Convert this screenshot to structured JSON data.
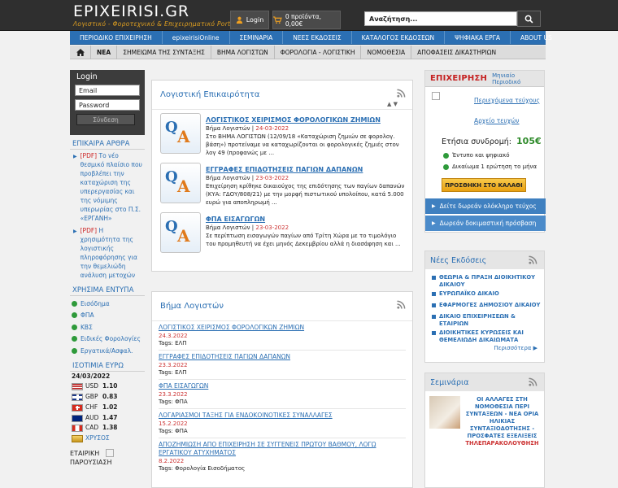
{
  "header": {
    "logo": "EPIXEIRISI.GR",
    "slogan": "Λογιστικό - Φοροτεχνικό & Επιχειρηματικό Portal",
    "login": "Login",
    "cart": "0 προϊόντα, 0,00€",
    "search_placeholder": "Αναζήτηση..."
  },
  "nav_main": [
    "ΠΕΡΙΟΔΙΚΟ ΕΠΙΧΕΙΡΗΣΗ",
    "epixeirisiOnline",
    "ΣΕΜΙΝΑΡΙΑ",
    "ΝΕΕΣ ΕΚΔΟΣΕΙΣ",
    "ΚΑΤΑΛΟΓΟΣ ΕΚΔΟΣΕΩΝ",
    "ΨΗΦΙΑΚΑ ΕΡΓΑ",
    "ABOUT US"
  ],
  "nav_sub": [
    "ΝΕΑ",
    "ΣΗΜΕΙΩΜΑ ΤΗΣ ΣΥΝΤΑΞΗΣ",
    "ΒΗΜΑ ΛΟΓΙΣΤΩΝ",
    "ΦΟΡΟΛΟΓΙΑ - ΛΟΓΙΣΤΙΚΗ",
    "ΝΟΜΟΘΕΣΙΑ",
    "ΑΠΟΦΑΣΕΙΣ ΔΙΚΑΣΤΗΡΙΩΝ"
  ],
  "login_box": {
    "title": "Login",
    "email": "Email",
    "password": "Password",
    "submit": "Σύνδεση"
  },
  "epikaira": {
    "title": "ΕΠΙΚΑΙΡΑ ΑΡΘΡΑ",
    "articles": [
      {
        "tag": "[PDF]",
        "text": "Το νέο θεσμικό πλαίσιο που προβλέπει την καταχώριση της υπερεργασίας και της νόμιμης υπερωρίας στο Π.Σ. «ΕΡΓΑΝΗ»"
      },
      {
        "tag": "[PDF]",
        "text": "Η χρησιμότητα της λογιστικής πληροφόρησης για την θεμελιώδη ανάλυση μετοχών"
      }
    ]
  },
  "forms": {
    "title": "ΧΡΗΣΙΜΑ ΕΝΤΥΠΑ",
    "items": [
      "Εισόδημα",
      "ΦΠΑ",
      "ΚΒΣ",
      "Ειδικές Φορολογίες",
      "Εργατικά/Ασφαλ."
    ]
  },
  "fx": {
    "title": "ΙΣΟΤΙΜΙΑ ΕΥΡΩ",
    "date": "24/03/2022",
    "rates": [
      {
        "cur": "USD",
        "val": "1.10",
        "flag": "#3c5aa6"
      },
      {
        "cur": "GBP",
        "val": "0.83",
        "flag": "#1f3a8a"
      },
      {
        "cur": "CHF",
        "val": "1.02",
        "flag": "#d52b1e"
      },
      {
        "cur": "AUD",
        "val": "1.47",
        "flag": "#00247d"
      },
      {
        "cur": "CAD",
        "val": "1.38",
        "flag": "#d52b1e"
      }
    ],
    "gold": "ΧΡΥΣΟΣ"
  },
  "presentation": {
    "text": "ΕΤΑΙΡΙΚΗ ΠΑΡΟΥΣΙΑΣΗ"
  },
  "news": {
    "title": "Λογιστική Επικαιρότητα",
    "sort": "▲ ▼",
    "items": [
      {
        "title": "ΛΟΓΙΣΤΙΚΟΣ ΧΕΙΡΙΣΜΟΣ ΦΟΡΟΛΟΓΙΚΩΝ ΖΗΜΙΩΝ",
        "section": "Βήμα Λογιστών",
        "date": "24-03-2022",
        "excerpt": "Στο ΒΗΜΑ ΛΟΓΙΣΤΩΝ (12/09/18 «Καταχώριση ζημιών σε φορολογ. βάση») προτείναμε να καταχωρίζονται οι φορολογικές ζημιές στον λογ 49 (προφανώς με ..."
      },
      {
        "title": "ΕΓΓΡΑΦΕΣ ΕΠΙΔΟΤΗΣΕΙΣ ΠΑΓΙΩΝ ΔΑΠΑΝΩΝ",
        "section": "Βήμα Λογιστών",
        "date": "23-03-2022",
        "excerpt": "Επιχείρηση κρίθηκε δικαιούχος της επιδότησης των παγίων δαπανών (ΚΥΑ: ΓΔΟΥ/808/21) με την μορφή πιστωτικού υπολοίπου, κατά 5.000 ευρώ για αποπληρωμή ..."
      },
      {
        "title": "ΦΠΑ ΕΙΣΑΓΩΓΩΝ",
        "section": "Βήμα Λογιστών",
        "date": "23-03-2022",
        "excerpt": "Σε περίπτωση εισαγωγών παγίων από Τρίτη Χώρα με το τιμολόγιο του προμηθευτή να έχει μηνός Δεκεμβρίου αλλά η διασάφηση και ..."
      }
    ]
  },
  "vima": {
    "title": "Βήμα Λογιστών",
    "items": [
      {
        "title": "ΛΟΓΙΣΤΙΚΟΣ ΧΕΙΡΙΣΜΟΣ ΦΟΡΟΛΟΓΙΚΩΝ ΖΗΜΙΩΝ",
        "date": "24.3.2022",
        "tag": "Tags: ΕΛΠ"
      },
      {
        "title": "ΕΓΓΡΑΦΕΣ ΕΠΙΔΟΤΗΣΕΙΣ ΠΑΓΙΩΝ ΔΑΠΑΝΩΝ",
        "date": "23.3.2022",
        "tag": "Tags: ΕΛΠ"
      },
      {
        "title": "ΦΠΑ ΕΙΣΑΓΩΓΩΝ",
        "date": "23.3.2022",
        "tag": "Tags: ΦΠΑ"
      },
      {
        "title": "ΛΟΓΑΡΙΑΣΜΟΙ ΤΑΞΗΣ ΓΙΑ ΕΝΔΟΚΟΙΝΟΤΙΚΕΣ ΣΥΝΑΛΛΑΓΕΣ",
        "date": "15.2.2022",
        "tag": "Tags: ΦΠΑ"
      },
      {
        "title": "ΑΠΟΖΗΜΙΩΣΗ ΑΠΟ ΕΠΙΧΕΙΡΗΣΗ ΣΕ ΣΥΓΓΕΝΕΙΣ ΠΡΩΤΟΥ ΒΑΘΜΟΥ, ΛΟΓΩ ΕΡΓΑΤΙΚΟΥ ΑΤΥΧΗΜΑΤΟΣ",
        "date": "8.2.2022",
        "tag": "Tags: Φορολογία Εισοδήματος"
      }
    ]
  },
  "magazine": {
    "brand": "ΕΠΙΧΕΙΡΗΣΗ",
    "subtitle": "Μηνιαίο Περιοδικό",
    "issues": "Περιεχόμενα τεύχους",
    "archive": "Αρχείο τευχών",
    "price_label": "Ετήσια συνδρομή:",
    "price": "105€",
    "feat1": "Έντυπο και ψηφιακό",
    "feat2": "Δικαίωμα 1 ερώτηση το μήνα",
    "cart": "ΠΡΟΣΘΗΚΗ ΣΤΟ ΚΑΛΑΘΙ",
    "free_issue": "Δείτε δωρεάν ολόκληρο τεύχος",
    "free_trial": "Δωρεάν δοκιμαστική πρόσβαση"
  },
  "releases": {
    "title": "Νέες Εκδόσεις",
    "items": [
      "ΘΕΩΡΙΑ & ΠΡΑΞΗ ΔΙΟΙΚΗΤΙΚΟΥ ΔΙΚΑΙΟΥ",
      "ΕΥΡΩΠΑΪΚΟ ΔΙΚΑΙΟ",
      "ΕΦΑΡΜΟΓΕΣ ΔΗΜΟΣΙΟΥ ΔΙΚΑΙΟΥ",
      "ΔΙΚΑΙΟ ΕΠΙΧΕΙΡΗΣΕΩΝ & ΕΤΑΙΡΙΩΝ",
      "ΔΙΟΙΚΗΤΙΚΕΣ ΚΥΡΩΣΕΙΣ ΚΑΙ ΘΕΜΕΛΙΩΔΗ ΔΙΚΑΙΩΜΑΤΑ"
    ],
    "more": "Περισσότερα ▶"
  },
  "seminars": {
    "title": "Σεμινάρια",
    "text": "ΟΙ ΑΛΛΑΓΕΣ ΣΤΗ ΝΟΜΟΘΕΣΙΑ ΠΕΡΙ ΣΥΝΤΑΞΕΩΝ - ΝΕΑ ΟΡΙΑ ΗΛΙΚΙΑΣ ΣΥΝΤΑΞΙΟΔΟΤΗΣΗΣ - ΠΡΟΣΦΑΤΕΣ ΕΞΕΛΙΞΕΙΣ",
    "live": "ΤΗΛΕΠΑΡΑΚΟΛΟΥΘΗΣΗ"
  },
  "colors": {
    "accent": "#2b6fb3",
    "brand": "#c52121",
    "green": "#2e8a2a",
    "date": "#cc3333"
  }
}
